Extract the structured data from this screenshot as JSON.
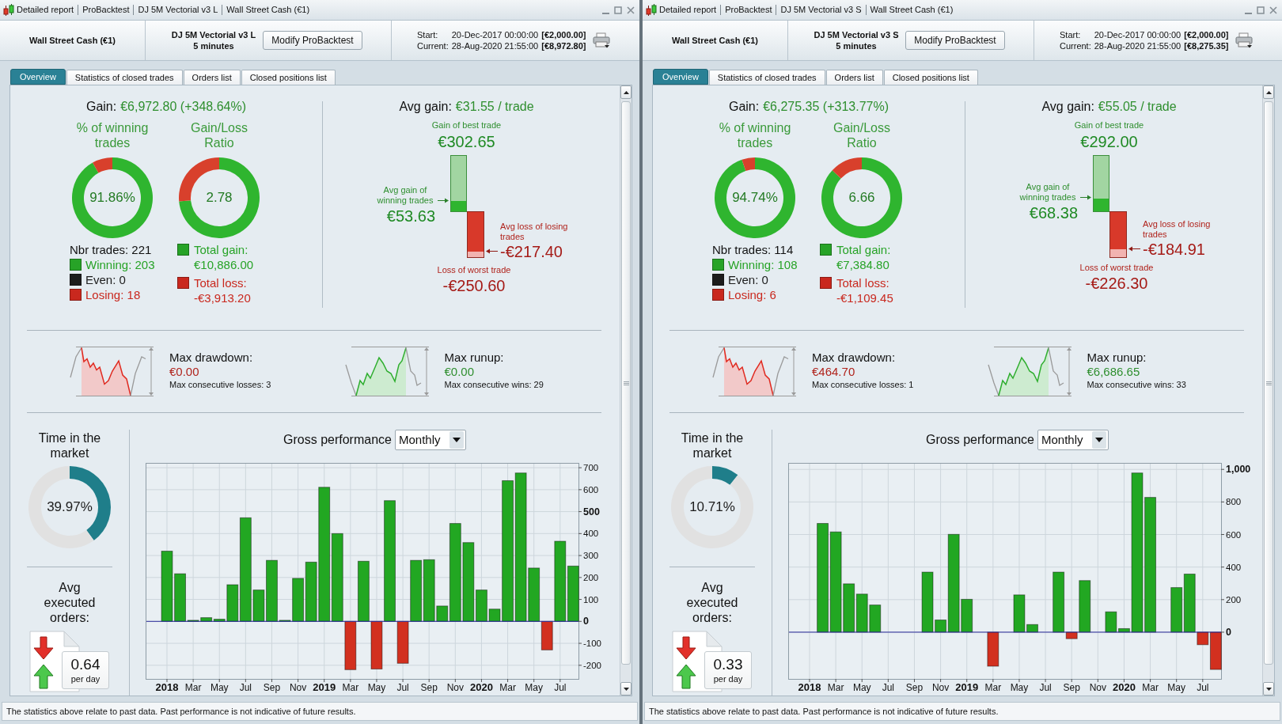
{
  "panels": [
    {
      "title_bar": [
        "Detailed report",
        "ProBacktest",
        "DJ 5M Vectorial v3 L",
        "Wall Street Cash (€1)"
      ],
      "header": {
        "instrument": "Wall Street Cash (€1)",
        "system": "DJ 5M Vectorial v3 L",
        "timeframe": "5 minutes",
        "button": "Modify ProBacktest",
        "rows": [
          {
            "label": "Start:",
            "date": "20-Dec-2017 00:00:00",
            "capital": "[€2,000.00]"
          },
          {
            "label": "Current:",
            "date": "28-Aug-2020 21:55:00",
            "capital": "[€8,972.80]"
          }
        ]
      },
      "tabs": [
        {
          "label": "Overview",
          "selected": true
        },
        {
          "label": "Statistics of closed trades",
          "selected": false
        },
        {
          "label": "Orders list",
          "selected": false
        },
        {
          "label": "Closed positions list",
          "selected": false
        }
      ],
      "gain": {
        "label": "Gain:",
        "value": "€6,972.80 (+348.64%)"
      },
      "winning_donut": {
        "title": "% of winning trades",
        "value": "91.86%",
        "chart_data": {
          "type": "donut",
          "categories": [
            null,
            null
          ],
          "values": [
            91.86,
            8.14
          ],
          "colors": [
            "#2fb52f",
            "#d8402c"
          ]
        }
      },
      "ratio_donut": {
        "title": "Gain/Loss Ratio",
        "value": "2.78",
        "chart_data": {
          "type": "donut",
          "categories": [
            null,
            null
          ],
          "values": [
            73.56,
            26.44
          ],
          "colors": [
            "#2fb52f",
            "#d8402c"
          ]
        }
      },
      "trade_counts": [
        {
          "label": "Nbr trades: 221"
        },
        {
          "label": "Winning: 203",
          "color": "#27a327"
        },
        {
          "label": "Even: 0",
          "color": "#1c1c1c"
        },
        {
          "label": "Losing: 18",
          "color": "#c9281e"
        }
      ],
      "totals": [
        {
          "label": "Total gain:",
          "value": "€10,886.00",
          "color": "#27a327"
        },
        {
          "label": "Total loss:",
          "value": "-€3,913.20",
          "color": "#c9281e"
        }
      ],
      "avg_gain": {
        "label": "Avg gain:",
        "value": "€31.55 / trade"
      },
      "best_trade": {
        "label": "Gain of best trade",
        "value": "€302.65"
      },
      "avg_winning": {
        "label": "Avg gain of winning trades",
        "value": "€53.63",
        "level": 0.18
      },
      "avg_losing": {
        "label": "Avg loss of losing trades",
        "value": "-€217.40",
        "level": 0.87
      },
      "worst_trade": {
        "label": "Loss of worst trade",
        "value": "-€250.60"
      },
      "extremes": [
        {
          "kind": "drawdown",
          "label": "Max drawdown:",
          "value": "€0.00",
          "detail": "Max consecutive losses: 3"
        },
        {
          "kind": "runup",
          "label": "Max runup:",
          "value": "€0.00",
          "detail": "Max consecutive wins: 29"
        }
      ],
      "time_in_market": {
        "title": "Time in the market",
        "value": "39.97%",
        "chart_data": {
          "type": "donut",
          "categories": [
            null,
            null
          ],
          "values": [
            39.97,
            60.03
          ],
          "colors": [
            "#1f7e8a",
            "#e1e1e1"
          ]
        }
      },
      "avg_orders": {
        "title": "Avg executed orders:",
        "value": "0.64",
        "unit": "per day"
      },
      "performance": {
        "period": "Monthly",
        "chart_data": {
          "type": "bar",
          "title": "Gross performance",
          "categories": [
            "2018",
            null,
            "Mar",
            null,
            "May",
            null,
            "Jul",
            null,
            "Sep",
            null,
            "Nov",
            null,
            "2019",
            null,
            "Mar",
            null,
            "May",
            null,
            "Jul",
            null,
            "Sep",
            null,
            "Nov",
            null,
            "2020",
            null,
            "Mar",
            null,
            "May",
            null,
            "Jul",
            null
          ],
          "series": [
            {
              "color": "#22a722",
              "values": [
                320,
                217,
                5,
                17,
                10,
                167,
                472,
                143,
                278,
                5,
                196,
                270,
                611,
                400,
                null,
                274,
                null,
                550,
                null,
                278,
                281,
                70,
                446,
                359,
                143,
                56,
                641,
                676,
                243,
                null,
                365,
                252
              ]
            },
            {
              "color": "#d2301f",
              "values": [
                null,
                null,
                null,
                null,
                null,
                null,
                null,
                null,
                null,
                null,
                null,
                null,
                null,
                null,
                -220,
                null,
                -217,
                null,
                -191,
                null,
                null,
                null,
                null,
                null,
                null,
                null,
                null,
                null,
                null,
                -130,
                null,
                null
              ]
            }
          ],
          "ylim": [
            -262,
            722
          ],
          "yticks": [
            -200,
            -100,
            0,
            100,
            200,
            300,
            400,
            500,
            600,
            700
          ],
          "grid": true,
          "ref_lines": [
            {
              "axis": "y",
              "value": 0,
              "color": "#2a2a9a"
            }
          ]
        }
      },
      "footer": "The statistics above relate to past data. Past performance is not indicative of future results."
    },
    {
      "title_bar": [
        "Detailed report",
        "ProBacktest",
        "DJ 5M Vectorial v3 S",
        "Wall Street Cash (€1)"
      ],
      "header": {
        "instrument": "Wall Street Cash (€1)",
        "system": "DJ 5M Vectorial v3 S",
        "timeframe": "5 minutes",
        "button": "Modify ProBacktest",
        "rows": [
          {
            "label": "Start:",
            "date": "20-Dec-2017 00:00:00",
            "capital": "[€2,000.00]"
          },
          {
            "label": "Current:",
            "date": "28-Aug-2020 21:55:00",
            "capital": "[€8,275.35]"
          }
        ]
      },
      "tabs": [
        {
          "label": "Overview",
          "selected": true
        },
        {
          "label": "Statistics of closed trades",
          "selected": false
        },
        {
          "label": "Orders list",
          "selected": false
        },
        {
          "label": "Closed positions list",
          "selected": false
        }
      ],
      "gain": {
        "label": "Gain:",
        "value": "€6,275.35 (+313.77%)"
      },
      "winning_donut": {
        "title": "% of winning trades",
        "value": "94.74%",
        "chart_data": {
          "type": "donut",
          "categories": [
            null,
            null
          ],
          "values": [
            94.74,
            5.26
          ],
          "colors": [
            "#2fb52f",
            "#d8402c"
          ]
        }
      },
      "ratio_donut": {
        "title": "Gain/Loss Ratio",
        "value": "6.66",
        "chart_data": {
          "type": "donut",
          "categories": [
            null,
            null
          ],
          "values": [
            86.94,
            13.06
          ],
          "colors": [
            "#2fb52f",
            "#d8402c"
          ]
        }
      },
      "trade_counts": [
        {
          "label": "Nbr trades: 114"
        },
        {
          "label": "Winning: 108",
          "color": "#27a327"
        },
        {
          "label": "Even: 0",
          "color": "#1c1c1c"
        },
        {
          "label": "Losing: 6",
          "color": "#c9281e"
        }
      ],
      "totals": [
        {
          "label": "Total gain:",
          "value": "€7,384.80",
          "color": "#27a327"
        },
        {
          "label": "Total loss:",
          "value": "-€1,109.45",
          "color": "#c9281e"
        }
      ],
      "avg_gain": {
        "label": "Avg gain:",
        "value": "€55.05 / trade"
      },
      "best_trade": {
        "label": "Gain of best trade",
        "value": "€292.00"
      },
      "avg_winning": {
        "label": "Avg gain of winning trades",
        "value": "€68.38",
        "level": 0.234
      },
      "avg_losing": {
        "label": "Avg loss of losing trades",
        "value": "-€184.91",
        "level": 0.817
      },
      "worst_trade": {
        "label": "Loss of worst trade",
        "value": "-€226.30"
      },
      "extremes": [
        {
          "kind": "drawdown",
          "label": "Max drawdown:",
          "value": "€464.70",
          "detail": "Max consecutive losses: 1"
        },
        {
          "kind": "runup",
          "label": "Max runup:",
          "value": "€6,686.65",
          "detail": "Max consecutive wins: 33"
        }
      ],
      "time_in_market": {
        "title": "Time in the market",
        "value": "10.71%",
        "chart_data": {
          "type": "donut",
          "categories": [
            null,
            null
          ],
          "values": [
            10.71,
            89.29
          ],
          "colors": [
            "#1f7e8a",
            "#e1e1e1"
          ]
        }
      },
      "avg_orders": {
        "title": "Avg executed orders:",
        "value": "0.33",
        "unit": "per day"
      },
      "performance": {
        "period": "Monthly",
        "chart_data": {
          "type": "bar",
          "title": "Gross performance",
          "categories": [
            "2018",
            null,
            "Mar",
            null,
            "May",
            null,
            "Jul",
            null,
            "Sep",
            null,
            "Nov",
            null,
            "2019",
            null,
            "Mar",
            null,
            "May",
            null,
            "Jul",
            null,
            "Sep",
            null,
            "Nov",
            null,
            "2020",
            null,
            "Mar",
            null,
            "May",
            null,
            "Jul",
            null
          ],
          "series": [
            {
              "color": "#22a722",
              "values": [
                0,
                668,
                616,
                297,
                234,
                167,
                0,
                0,
                0,
                369,
                75,
                601,
                202,
                0,
                null,
                0,
                229,
                47,
                0,
                369,
                null,
                317,
                0,
                125,
                22,
                978,
                828,
                0,
                274,
                357,
                null,
                null
              ]
            },
            {
              "color": "#d2301f",
              "values": [
                null,
                null,
                null,
                null,
                null,
                null,
                null,
                null,
                null,
                null,
                null,
                null,
                null,
                null,
                -209,
                null,
                null,
                null,
                null,
                null,
                -40,
                null,
                null,
                null,
                null,
                null,
                null,
                null,
                null,
                null,
                -77,
                -229
              ]
            }
          ],
          "ylim": [
            -287,
            1040
          ],
          "yticks": [
            0,
            200,
            400,
            600,
            800,
            {
              "value": 1000,
              "label": "1,000"
            }
          ],
          "grid": true,
          "ref_lines": [
            {
              "axis": "y",
              "value": 0,
              "color": "#2a2a9a"
            }
          ]
        }
      },
      "footer": "The statistics above relate to past data. Past performance is not indicative of future results."
    }
  ]
}
